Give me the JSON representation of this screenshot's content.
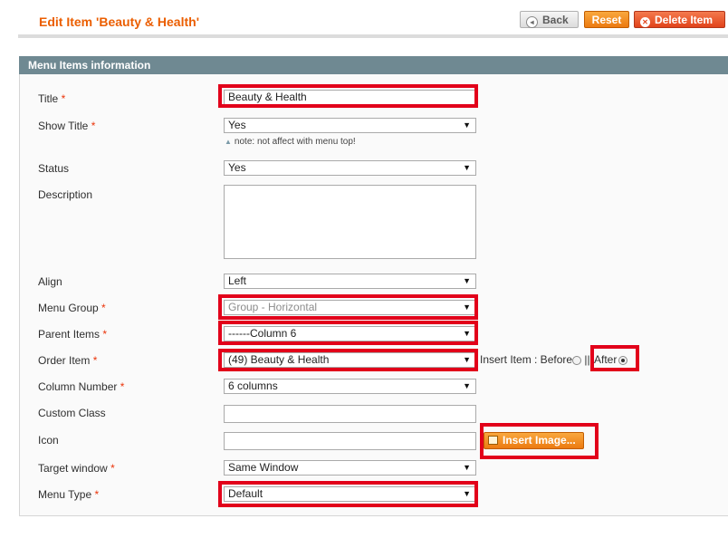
{
  "header": {
    "title": "Edit Item 'Beauty & Health'",
    "back_label": "Back",
    "reset_label": "Reset",
    "delete_label": "Delete Item"
  },
  "section": {
    "title": "Menu Items information"
  },
  "required_mark": "*",
  "fields": {
    "title": {
      "label": "Title",
      "value": "Beauty & Health"
    },
    "show_title": {
      "label": "Show Title",
      "value": "Yes",
      "note": "note: not affect with menu top!"
    },
    "status": {
      "label": "Status",
      "value": "Yes"
    },
    "description": {
      "label": "Description",
      "value": ""
    },
    "align": {
      "label": "Align",
      "value": "Left"
    },
    "menu_group": {
      "label": "Menu Group",
      "value": "Group - Horizontal"
    },
    "parent_items": {
      "label": "Parent Items",
      "value": "------Column 6"
    },
    "order_item": {
      "label": "Order Item",
      "value": "(49) Beauty & Health",
      "insert_label": "Insert Item : Before",
      "separator": "||",
      "after_label": "After"
    },
    "column_number": {
      "label": "Column Number",
      "value": "6 columns"
    },
    "custom_class": {
      "label": "Custom Class",
      "value": ""
    },
    "icon": {
      "label": "Icon",
      "value": "",
      "button_label": "Insert Image..."
    },
    "target_window": {
      "label": "Target window",
      "value": "Same Window"
    },
    "menu_type": {
      "label": "Menu Type",
      "value": "Default"
    }
  },
  "icons": {
    "back": "circle-arrow-left-icon",
    "delete": "circle-x-icon",
    "dropdown": "triangle-down-icon",
    "note": "triangle-up-icon",
    "insert_image": "image-icon"
  },
  "colors": {
    "title": "#eb5e00",
    "section_bar": "#6f8992",
    "highlight": "#e2001a",
    "orange_button": "#ec7a10",
    "delete_button": "#e1431a",
    "required": "#eb340a"
  },
  "arrow_glyph": "▼",
  "note_glyph": "▲"
}
